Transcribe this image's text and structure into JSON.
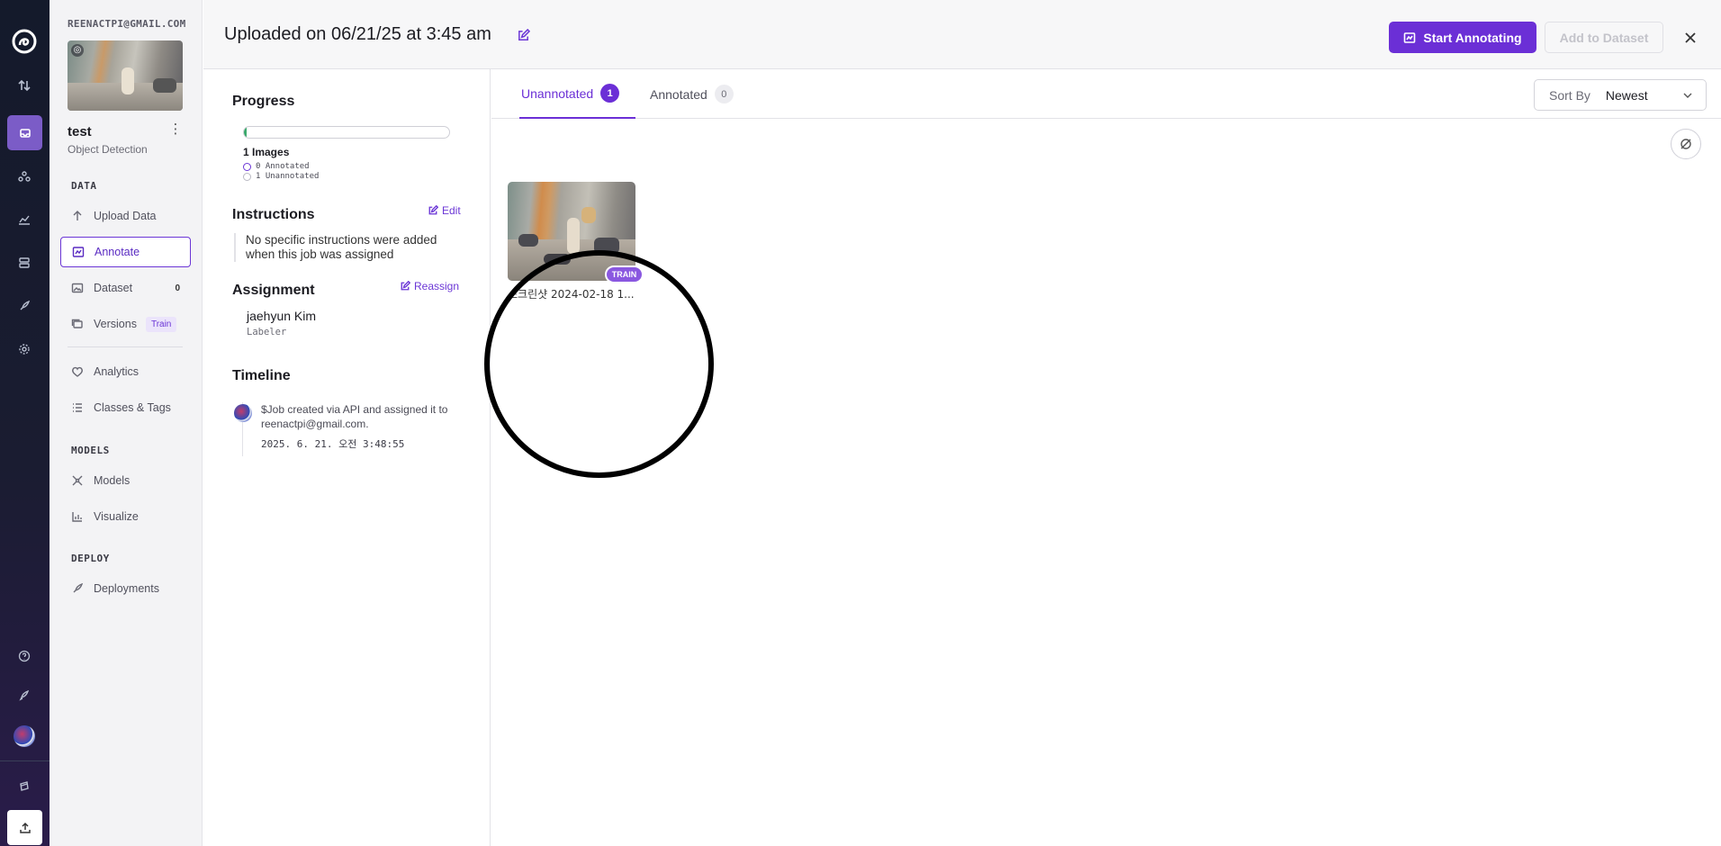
{
  "workspace": {
    "name": "REENACTPI@GMAIL.COM"
  },
  "project": {
    "name": "test",
    "type": "Object Detection"
  },
  "sidebar": {
    "sections": [
      {
        "title": "DATA"
      },
      {
        "title": "MODELS"
      },
      {
        "title": "DEPLOY"
      }
    ],
    "items": [
      {
        "label": "Upload Data",
        "icon": "upload-icon"
      },
      {
        "label": "Annotate",
        "icon": "annotate-icon",
        "active": true
      },
      {
        "label": "Dataset",
        "icon": "dataset-icon",
        "count": "0"
      },
      {
        "label": "Versions",
        "icon": "versions-icon",
        "tag": "Train"
      },
      {
        "label": "Analytics",
        "icon": "analytics-icon"
      },
      {
        "label": "Classes & Tags",
        "icon": "list-icon"
      },
      {
        "label": "Models",
        "icon": "models-icon"
      },
      {
        "label": "Visualize",
        "icon": "chart-icon"
      },
      {
        "label": "Deployments",
        "icon": "rocket-icon"
      }
    ]
  },
  "header": {
    "title": "Uploaded on 06/21/25 at 3:45 am",
    "start_label": "Start Annotating",
    "add_label": "Add to Dataset"
  },
  "details": {
    "progress_title": "Progress",
    "progress_fraction": 0.0,
    "images_label": "1 Images",
    "annotated_label": "0 Annotated",
    "unannotated_label": "1 Unannotated",
    "instructions_title": "Instructions",
    "edit_label": "Edit",
    "instructions_text": "No specific instructions were added when this job was assigned",
    "assignment_title": "Assignment",
    "reassign_label": "Reassign",
    "assignee": "jaehyun Kim",
    "role": "Labeler",
    "timeline_title": "Timeline",
    "timeline_text": "$Job created via API and assigned it to reenactpi@gmail.com.",
    "timeline_time": "2025. 6. 21. 오전 3:48:55"
  },
  "tabs": [
    {
      "label": "Unannotated",
      "count": "1"
    },
    {
      "label": "Annotated",
      "count": "0"
    }
  ],
  "sort": {
    "label": "Sort By",
    "value": "Newest"
  },
  "images": [
    {
      "filename": "스크린샷 2024-02-18 1...",
      "split": "TRAIN"
    }
  ],
  "colors": {
    "accent": "#6b2fd6",
    "progress": "#39a96b",
    "rail": "#141a2b"
  }
}
